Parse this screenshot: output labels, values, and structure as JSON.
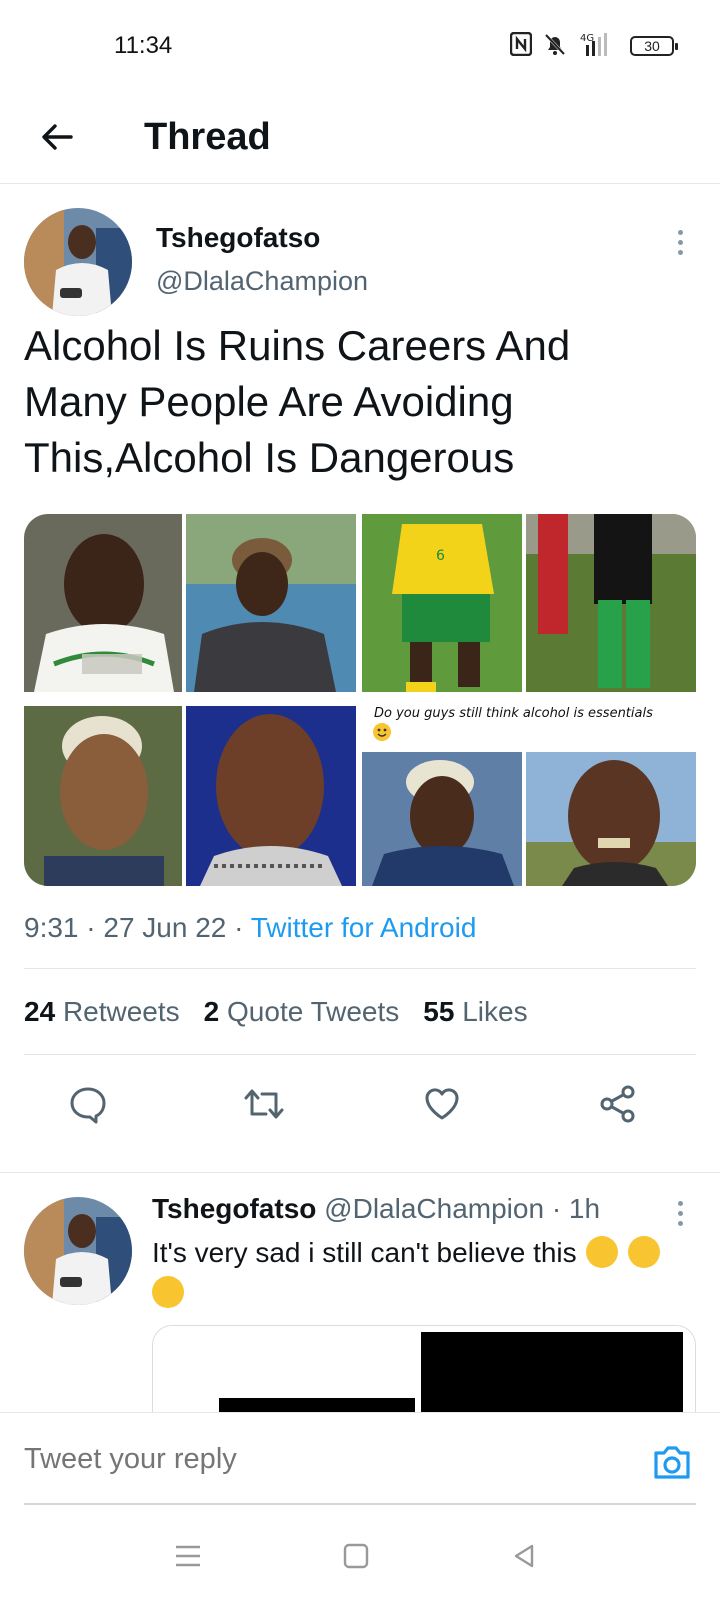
{
  "status_bar": {
    "time": "11:34",
    "network": "4G",
    "battery": "30",
    "icons": [
      "nfc-icon",
      "mute-bell-icon",
      "signal-icon",
      "battery-icon"
    ]
  },
  "header": {
    "title": "Thread",
    "back_icon": "arrow-left-icon"
  },
  "tweet": {
    "author_name": "Tshegofatso",
    "author_handle": "@DlalaChampion",
    "text": "Alcohol Is Ruins Careers And Many People Are Avoiding This,Alcohol Is Dangerous",
    "media_caption": "Do you guys still think alcohol is essentials",
    "meta_time": "9:31 · 27 Jun 22 · ",
    "meta_source": "Twitter for Android",
    "stats": {
      "retweets_count": "24",
      "retweets_label": "Retweets",
      "quotes_count": "2",
      "quotes_label": "Quote Tweets",
      "likes_count": "55",
      "likes_label": "Likes"
    },
    "actions": [
      "reply-icon",
      "retweet-icon",
      "like-icon",
      "share-icon"
    ]
  },
  "reply": {
    "author_name": "Tshegofatso",
    "author_handle": "@DlalaChampion",
    "time": "· 1h",
    "text": "It's very sad i still can't believe this"
  },
  "reply_bar": {
    "placeholder": "Tweet your reply"
  },
  "colors": {
    "accent": "#1d9bf0",
    "text_primary": "#0f1419",
    "text_secondary": "#536471"
  }
}
